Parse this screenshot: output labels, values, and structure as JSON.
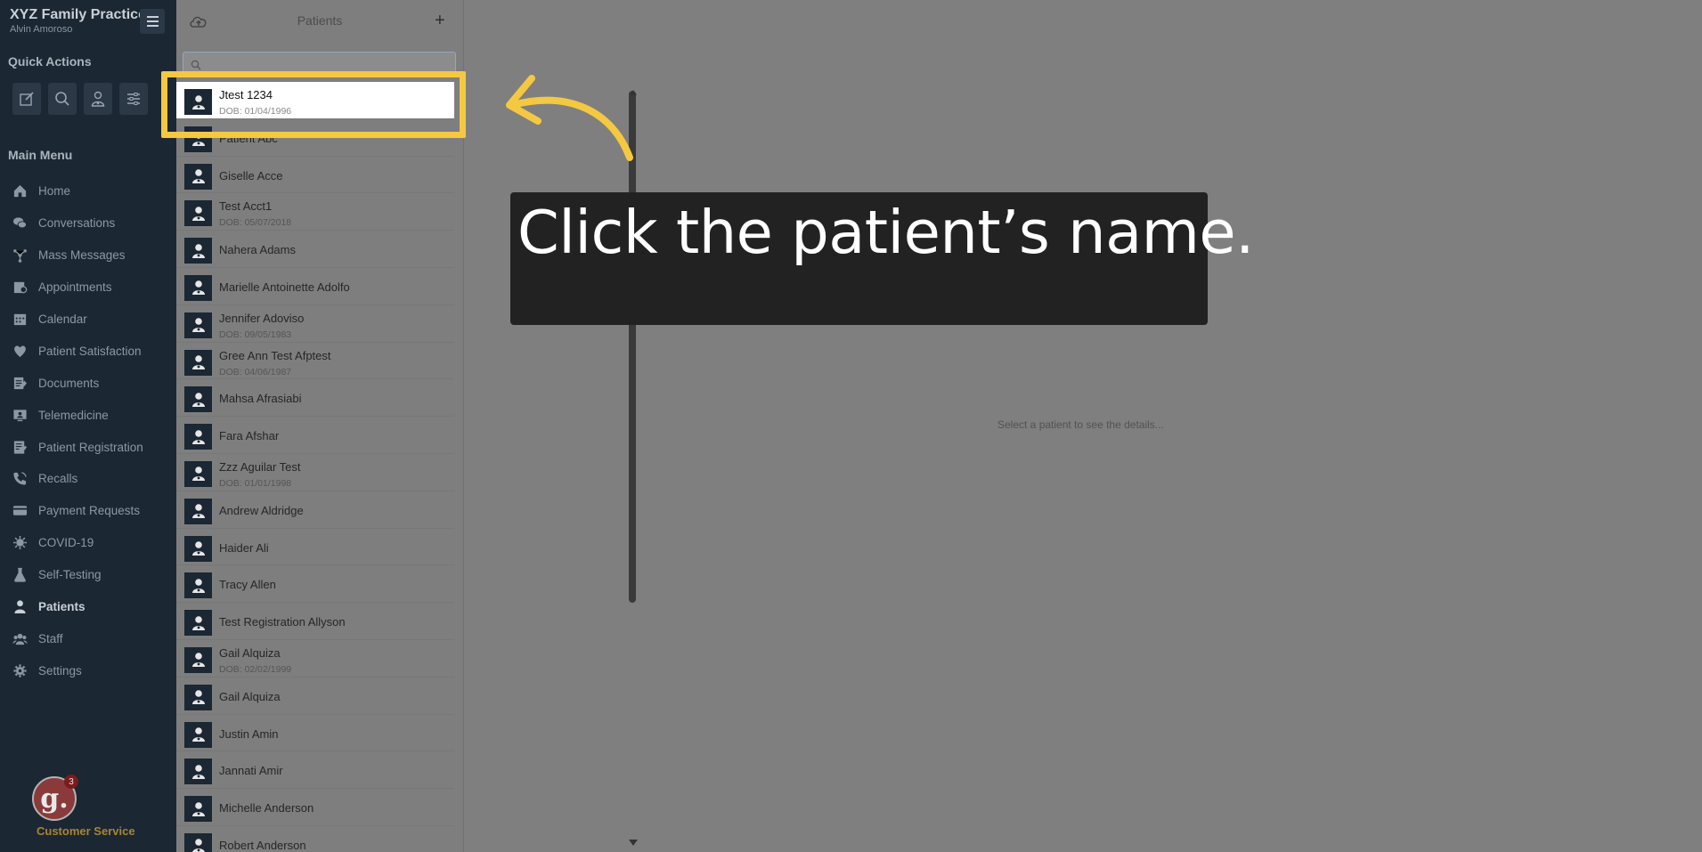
{
  "sidebar": {
    "brand_name": "XYZ Family Practice",
    "user_name": "Alvin Amoroso",
    "quick_actions_title": "Quick Actions",
    "quick_actions": [
      "edit-icon",
      "search-icon",
      "doctor-icon",
      "sliders-icon"
    ],
    "main_menu_title": "Main Menu",
    "menu": [
      {
        "label": "Home",
        "icon": "home-icon"
      },
      {
        "label": "Conversations",
        "icon": "chat-icon"
      },
      {
        "label": "Mass Messages",
        "icon": "broadcast-icon"
      },
      {
        "label": "Appointments",
        "icon": "appointments-icon"
      },
      {
        "label": "Calendar",
        "icon": "calendar-icon"
      },
      {
        "label": "Patient Satisfaction",
        "icon": "heart-icon"
      },
      {
        "label": "Documents",
        "icon": "documents-icon"
      },
      {
        "label": "Telemedicine",
        "icon": "telemedicine-icon"
      },
      {
        "label": "Patient Registration",
        "icon": "registration-icon"
      },
      {
        "label": "Recalls",
        "icon": "phone-icon"
      },
      {
        "label": "Payment Requests",
        "icon": "card-icon"
      },
      {
        "label": "COVID-19",
        "icon": "virus-icon"
      },
      {
        "label": "Self-Testing",
        "icon": "flask-icon"
      },
      {
        "label": "Patients",
        "icon": "patient-icon",
        "active": true
      },
      {
        "label": "Staff",
        "icon": "staff-icon"
      },
      {
        "label": "Settings",
        "icon": "gear-icon"
      }
    ],
    "customer_service": {
      "logo_letter": "g.",
      "badge": "3",
      "label": "Customer Service"
    }
  },
  "patients_panel": {
    "title": "Patients",
    "add_label": "+",
    "search_value": "",
    "search_placeholder": "",
    "patients": [
      {
        "name": "Jtest 1234",
        "dob": "DOB: 01/04/1996"
      },
      {
        "name": "Patient Abc",
        "dob": ""
      },
      {
        "name": "Giselle Acce",
        "dob": ""
      },
      {
        "name": "Test Acct1",
        "dob": "DOB: 05/07/2018"
      },
      {
        "name": "Nahera Adams",
        "dob": ""
      },
      {
        "name": "Marielle Antoinette Adolfo",
        "dob": ""
      },
      {
        "name": "Jennifer Adoviso",
        "dob": "DOB: 09/05/1983"
      },
      {
        "name": "Gree Ann Test Afptest",
        "dob": "DOB: 04/06/1987"
      },
      {
        "name": "Mahsa Afrasiabi",
        "dob": ""
      },
      {
        "name": "Fara Afshar",
        "dob": ""
      },
      {
        "name": "Zzz Aguilar Test",
        "dob": "DOB: 01/01/1998"
      },
      {
        "name": "Andrew Aldridge",
        "dob": ""
      },
      {
        "name": "Haider Ali",
        "dob": ""
      },
      {
        "name": "Tracy Allen",
        "dob": ""
      },
      {
        "name": "Test Registration Allyson",
        "dob": ""
      },
      {
        "name": "Gail Alquiza",
        "dob": "DOB: 02/02/1999"
      },
      {
        "name": "Gail Alquiza",
        "dob": ""
      },
      {
        "name": "Justin Amin",
        "dob": ""
      },
      {
        "name": "Jannati Amir",
        "dob": ""
      },
      {
        "name": "Michelle Anderson",
        "dob": ""
      },
      {
        "name": "Robert Anderson",
        "dob": ""
      }
    ]
  },
  "main": {
    "empty_message": "Select a patient to see the details..."
  },
  "overlay": {
    "instruction": "Click the patient’s name.",
    "highlight_color": "#f5c842"
  }
}
